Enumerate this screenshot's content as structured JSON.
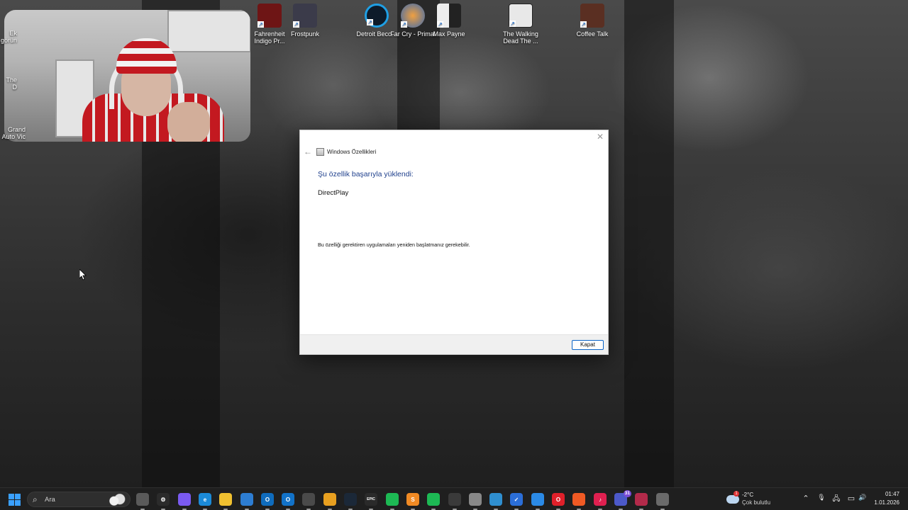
{
  "desktop": {
    "icons": [
      {
        "label": "Fahrenheit Indigo Pr...",
        "color": "#8a1b1b",
        "name": "fahrenheit"
      },
      {
        "label": "Frostpunk",
        "color": "#3b3b4a",
        "name": "frostpunk"
      },
      {
        "label": "Detroit Beco...",
        "color": "#1f7fc4",
        "name": "detroit"
      },
      {
        "label": "Far Cry - Primal",
        "color": "#d9822b",
        "name": "far-cry-primal"
      },
      {
        "label": "Max Payne",
        "color": "#e6e6e6",
        "name": "max-payne"
      },
      {
        "label": "The Walking Dead The ...",
        "color": "#e8e8e8",
        "name": "walking-dead"
      },
      {
        "label": "Coffee Talk",
        "color": "#6b3c2a",
        "name": "coffee-talk"
      }
    ],
    "edge_icons": [
      {
        "label": "Ek görün"
      },
      {
        "label": "The D"
      },
      {
        "label": "Grand Auto Vic"
      }
    ]
  },
  "dialog": {
    "title": "Windows Özellikleri",
    "heading": "Şu özellik başarıyla yüklendi:",
    "feature": "DirectPlay",
    "note": "Bu özelliği gerektiren uygulamaları yeniden başlatmanız gerekebilir.",
    "close_button": "Kapat",
    "close_glyph": "✕",
    "back_glyph": "←",
    "heading_color": "#1e3f8c"
  },
  "taskbar": {
    "search_placeholder": "Ara",
    "apps": [
      {
        "name": "task-view",
        "color": "#5a5a5a",
        "glyph": ""
      },
      {
        "name": "copilot",
        "color": "#2b2b2b",
        "glyph": "⚙"
      },
      {
        "name": "copilot-alt",
        "color": "#7a5af0",
        "glyph": ""
      },
      {
        "name": "edge",
        "color": "#1b8ad8",
        "glyph": "e"
      },
      {
        "name": "file-explorer",
        "color": "#f0c030",
        "glyph": ""
      },
      {
        "name": "store",
        "color": "#2d7dd2",
        "glyph": ""
      },
      {
        "name": "outlook",
        "color": "#0f6cbd",
        "glyph": "O"
      },
      {
        "name": "outlook-new",
        "color": "#1272c8",
        "glyph": "O"
      },
      {
        "name": "calculator",
        "color": "#4a4a4a",
        "glyph": ""
      },
      {
        "name": "chrome",
        "color": "#e8a020",
        "glyph": ""
      },
      {
        "name": "steam",
        "color": "#1b2838",
        "glyph": ""
      },
      {
        "name": "epic-games",
        "color": "#2a2a2a",
        "glyph": "EPIC"
      },
      {
        "name": "xbox-game-bar",
        "color": "#1db954",
        "glyph": ""
      },
      {
        "name": "sublime",
        "color": "#f08a24",
        "glyph": "S"
      },
      {
        "name": "spotify",
        "color": "#1db954",
        "glyph": ""
      },
      {
        "name": "obs",
        "color": "#3a3a3a",
        "glyph": ""
      },
      {
        "name": "nordvpn",
        "color": "#888888",
        "glyph": ""
      },
      {
        "name": "browser-globe",
        "color": "#2f8fd0",
        "glyph": ""
      },
      {
        "name": "todo",
        "color": "#2b6ed8",
        "glyph": "✓"
      },
      {
        "name": "messenger",
        "color": "#2b8ae6",
        "glyph": ""
      },
      {
        "name": "opera",
        "color": "#e0202a",
        "glyph": "O"
      },
      {
        "name": "brave",
        "color": "#f05a24",
        "glyph": ""
      },
      {
        "name": "tiktok",
        "color": "#e02050",
        "glyph": "♪"
      },
      {
        "name": "teams",
        "color": "#4c59c9",
        "glyph": "",
        "badge": "31"
      },
      {
        "name": "photos",
        "color": "#b32a4a",
        "glyph": ""
      },
      {
        "name": "notepad",
        "color": "#6a6a6a",
        "glyph": ""
      }
    ],
    "weather": {
      "alert": "1",
      "temp": "-2°C",
      "condition": "Çok bulutlu"
    },
    "tray": {
      "chevron": "⌃",
      "mic": "🎙",
      "network": "🖧",
      "display": "▭",
      "volume": "🔊"
    },
    "clock": {
      "time": "01:47",
      "date": "1.01.2026"
    }
  }
}
